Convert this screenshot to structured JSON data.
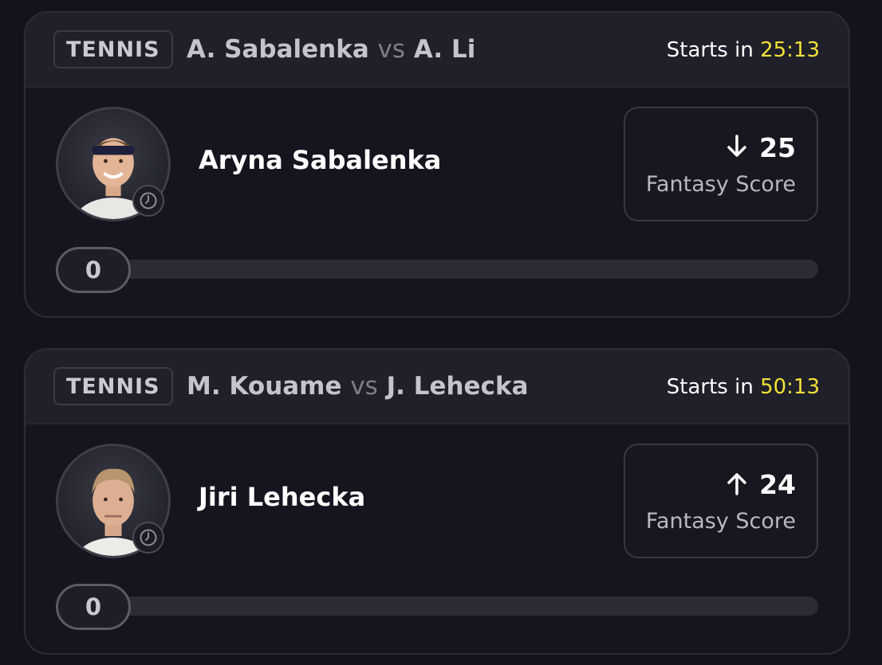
{
  "cards": [
    {
      "sport": "TENNIS",
      "player_a": "A. Sabalenka",
      "vs": "vs",
      "player_b": "A. Li",
      "starts_label": "Starts in",
      "timer": "25:13",
      "player_name": "Aryna Sabalenka",
      "direction_icon": "arrow-down-icon",
      "score": "25",
      "score_label": "Fantasy Score",
      "count": "0"
    },
    {
      "sport": "TENNIS",
      "player_a": "M. Kouame",
      "vs": "vs",
      "player_b": "J. Lehecka",
      "starts_label": "Starts in",
      "timer": "50:13",
      "player_name": "Jiri Lehecka",
      "direction_icon": "arrow-up-icon",
      "score": "24",
      "score_label": "Fantasy Score",
      "count": "0"
    }
  ],
  "colors": {
    "background": "#12131c",
    "timer": "#f3e13a",
    "card_header": "#1f2029"
  }
}
